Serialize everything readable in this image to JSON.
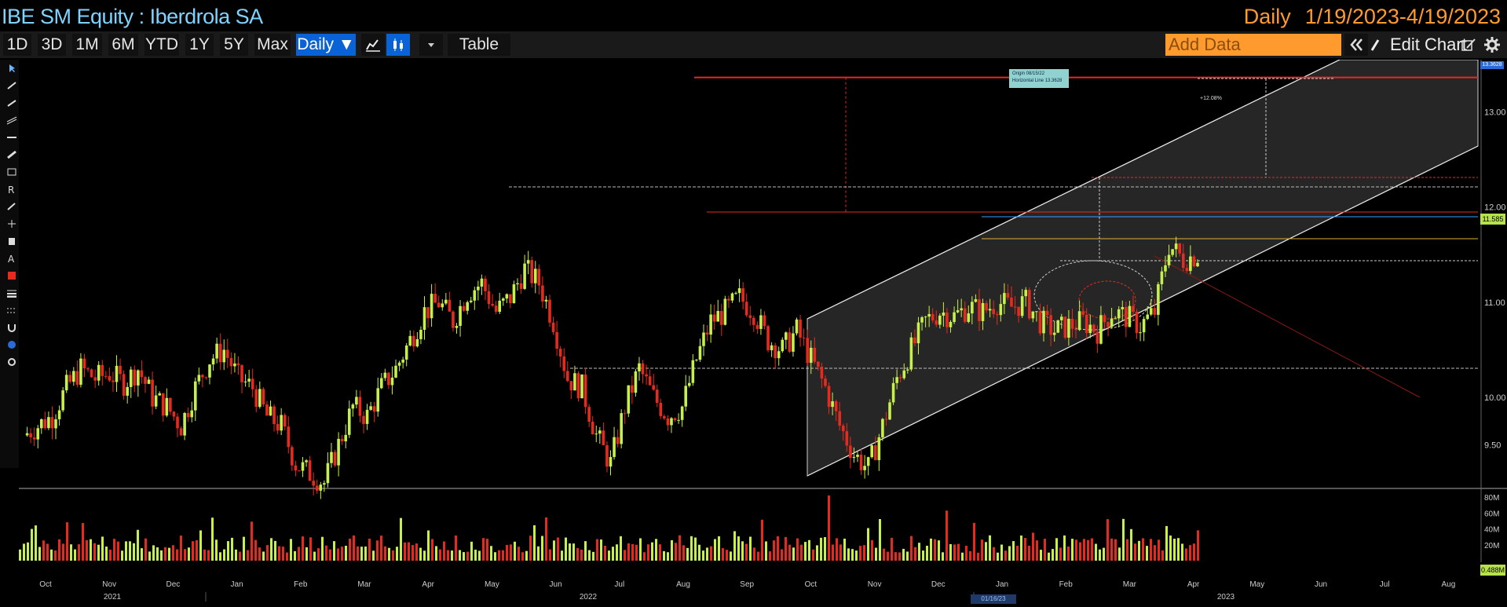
{
  "header": {
    "title": "IBE SM Equity : Iberdrola SA",
    "frequency": "Daily",
    "date_range": "1/19/2023-4/19/2023"
  },
  "toolbar": {
    "periods": [
      "1D",
      "3D",
      "1M",
      "6M",
      "YTD",
      "1Y",
      "5Y",
      "Max"
    ],
    "frequency_button": "Daily ▼",
    "table_label": "Table",
    "add_data_placeholder": "Add Data",
    "edit_chart_label": "Edit Chart"
  },
  "annotation": {
    "tooltip_line1": "Origin 08/15/22",
    "tooltip_line2": "Horizontal Line 13.3628",
    "pct_label": "+12.08%",
    "top_price_tag": "13.3628",
    "last_price": "11.585",
    "volume_last": "0.488M",
    "cursor_date": "01/16/23"
  },
  "colors": {
    "up": "#c6f04a",
    "down": "#e52b1f",
    "channel_fill": "#262626",
    "title": "#7fd3ff",
    "accent": "#ff9a2e",
    "selected": "#0a63d6"
  },
  "chart_data": {
    "type": "candlestick",
    "y_ticks": [
      "13.00",
      "12.00",
      "11.00",
      "10.00",
      "9.50"
    ],
    "y_range": [
      9.05,
      13.55
    ],
    "volume_ticks": [
      "80M",
      "60M",
      "40M",
      "20M"
    ],
    "volume_range": [
      0,
      85
    ],
    "month_labels": [
      "Oct",
      "Nov",
      "Dec",
      "Jan",
      "Feb",
      "Mar",
      "Apr",
      "May",
      "Jun",
      "Jul",
      "Aug",
      "Sep",
      "Oct",
      "Nov",
      "Dec",
      "Jan",
      "Feb",
      "Mar",
      "Apr",
      "May",
      "Jun",
      "Jul",
      "Aug"
    ],
    "year_labels": [
      "2021",
      "2022",
      "2023"
    ],
    "close_series": [
      9.6,
      9.7,
      9.8,
      10.1,
      10.3,
      10.2,
      10.25,
      10.15,
      10.3,
      10.0,
      9.9,
      9.7,
      10.1,
      10.4,
      10.5,
      10.2,
      10.1,
      9.8,
      9.7,
      9.3,
      9.2,
      9.1,
      9.5,
      9.9,
      9.8,
      10.1,
      10.3,
      10.6,
      10.9,
      11.0,
      10.8,
      11.1,
      11.2,
      10.9,
      11.05,
      11.35,
      11.2,
      10.8,
      10.2,
      10.1,
      9.6,
      9.3,
      9.9,
      10.3,
      10.0,
      9.8,
      9.9,
      10.4,
      10.8,
      10.9,
      11.05,
      10.9,
      10.6,
      10.5,
      10.7,
      10.4,
      10.1,
      9.7,
      9.4,
      9.25,
      9.7,
      10.2,
      10.5,
      10.8,
      10.9,
      10.85,
      10.95,
      10.9,
      11.0,
      10.95,
      11.0,
      10.8,
      10.7,
      10.75,
      10.8,
      10.7,
      10.9,
      10.85,
      10.75,
      10.9,
      11.6,
      11.45,
      11.5
    ],
    "horizontal_lines": [
      13.3628
    ]
  }
}
